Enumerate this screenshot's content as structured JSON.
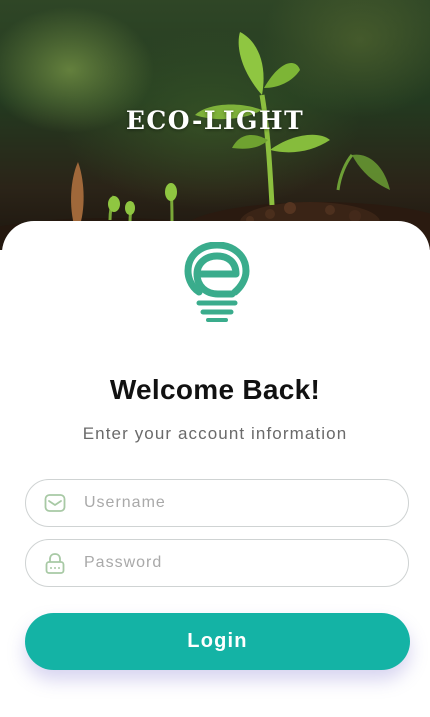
{
  "brand": {
    "name": "ECO-LIGHT"
  },
  "hero": {
    "image": "seedling-sprouting-from-soil"
  },
  "logo": {
    "icon": "lightbulb-e-logo-icon"
  },
  "welcome": {
    "title": "Welcome Back!",
    "subtitle": "Enter your account information"
  },
  "form": {
    "username": {
      "placeholder": "Username",
      "value": "",
      "icon": "mail-icon"
    },
    "password": {
      "placeholder": "Password",
      "value": "",
      "icon": "lock-icon"
    },
    "login_label": "Login"
  },
  "colors": {
    "accent": "#14b3a5",
    "logo": "#3aac8c",
    "field_icon": "#a8c9a5"
  }
}
